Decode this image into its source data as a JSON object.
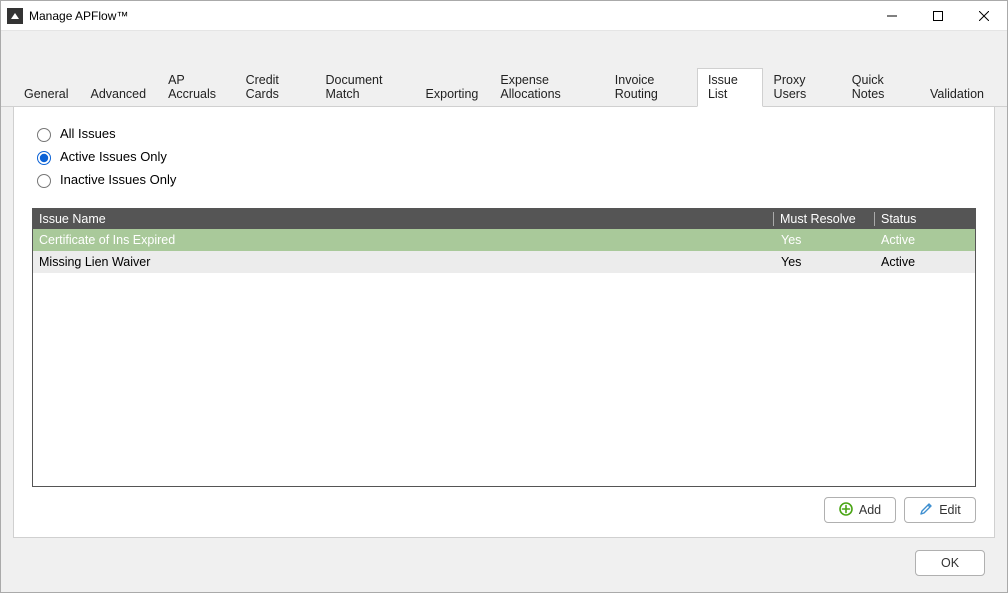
{
  "window": {
    "title": "Manage APFlow™"
  },
  "tabs": [
    {
      "label": "General",
      "active": false
    },
    {
      "label": "Advanced",
      "active": false
    },
    {
      "label": "AP Accruals",
      "active": false
    },
    {
      "label": "Credit Cards",
      "active": false
    },
    {
      "label": "Document Match",
      "active": false
    },
    {
      "label": "Exporting",
      "active": false
    },
    {
      "label": "Expense Allocations",
      "active": false
    },
    {
      "label": "Invoice Routing",
      "active": false
    },
    {
      "label": "Issue List",
      "active": true
    },
    {
      "label": "Proxy Users",
      "active": false
    },
    {
      "label": "Quick Notes",
      "active": false
    },
    {
      "label": "Validation",
      "active": false
    }
  ],
  "filters": {
    "all_label": "All Issues",
    "active_label": "Active Issues Only",
    "inactive_label": "Inactive Issues Only",
    "selected": "active"
  },
  "grid": {
    "columns": {
      "name": "Issue Name",
      "must_resolve": "Must Resolve",
      "status": "Status"
    },
    "rows": [
      {
        "name": "Certificate of Ins Expired",
        "must_resolve": "Yes",
        "status": "Active",
        "selected": true
      },
      {
        "name": "Missing Lien Waiver",
        "must_resolve": "Yes",
        "status": "Active",
        "selected": false
      }
    ]
  },
  "buttons": {
    "add": "Add",
    "edit": "Edit",
    "ok": "OK"
  },
  "colors": {
    "selected_row": "#a9c99a",
    "accent": "#0b62d6",
    "add_icon": "#4aa515",
    "edit_icon": "#3e8fd0"
  }
}
